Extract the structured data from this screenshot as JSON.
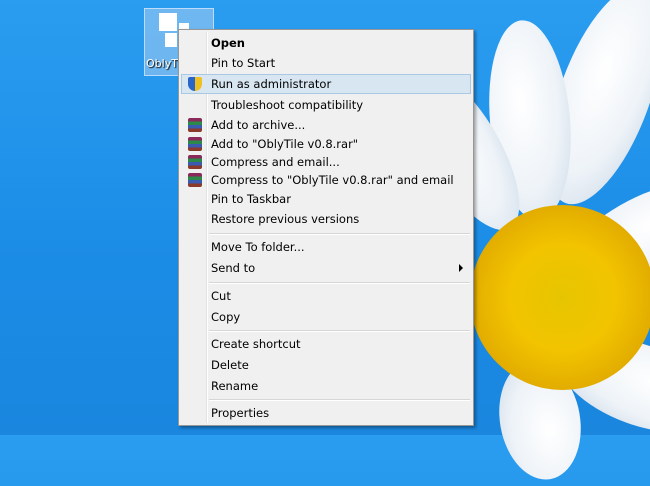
{
  "desktop": {
    "icon_label": "OblyTile"
  },
  "menu": {
    "items": [
      {
        "label": "Open"
      },
      {
        "label": "Pin to Start"
      },
      {
        "label": "Run as administrator"
      },
      {
        "label": "Troubleshoot compatibility"
      },
      {
        "label": "Add to archive..."
      },
      {
        "label": "Add to \"OblyTile v0.8.rar\""
      },
      {
        "label": "Compress and email..."
      },
      {
        "label": "Compress to \"OblyTile v0.8.rar\" and email"
      },
      {
        "label": "Pin to Taskbar"
      },
      {
        "label": "Restore previous versions"
      },
      {
        "label": "Move To folder..."
      },
      {
        "label": "Send to"
      },
      {
        "label": "Cut"
      },
      {
        "label": "Copy"
      },
      {
        "label": "Create shortcut"
      },
      {
        "label": "Delete"
      },
      {
        "label": "Rename"
      },
      {
        "label": "Properties"
      }
    ]
  }
}
